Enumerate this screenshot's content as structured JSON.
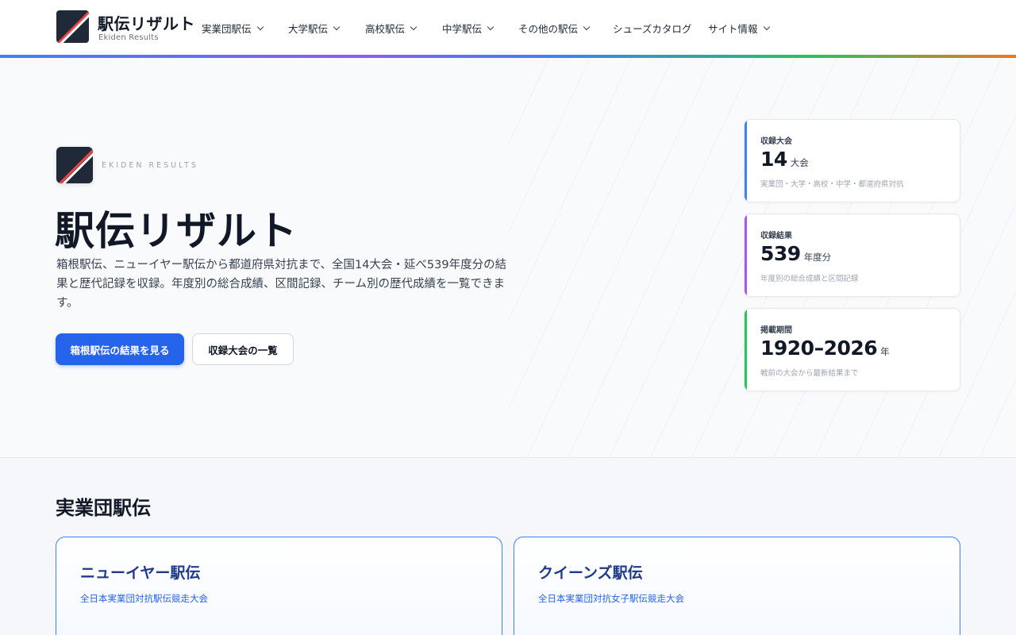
{
  "site": {
    "title": "駅伝リザルト",
    "subtitle": "Ekiden Results"
  },
  "nav": {
    "items": [
      {
        "label": "実業団駅伝",
        "dropdown": true
      },
      {
        "label": "大学駅伝",
        "dropdown": true
      },
      {
        "label": "高校駅伝",
        "dropdown": true
      },
      {
        "label": "中学駅伝",
        "dropdown": true
      },
      {
        "label": "その他の駅伝",
        "dropdown": true
      },
      {
        "label": "シューズカタログ",
        "dropdown": false
      },
      {
        "label": "サイト情報",
        "dropdown": true
      }
    ]
  },
  "hero": {
    "eyebrow": "EKIDEN RESULTS",
    "title": "駅伝リザルト",
    "description": "箱根駅伝、ニューイヤー駅伝から都道府県対抗まで、全国14大会・延べ539年度分の結果と歴代記録を収録。年度別の総合成績、区間記録、チーム別の歴代成績を一覧できます。",
    "primary_button": "箱根駅伝の結果を見る",
    "secondary_button": "収録大会の一覧"
  },
  "stats": [
    {
      "label": "収録大会",
      "value": "14",
      "unit": "大会",
      "note": "実業団・大学・高校・中学・都道府県対抗",
      "color": "#3b82f6"
    },
    {
      "label": "収録結果",
      "value": "539",
      "unit": "年度分",
      "note": "年度別の総合成績と区間記録",
      "color": "#a855f7"
    },
    {
      "label": "掲載期間",
      "value": "1920–2026",
      "unit": "年",
      "note": "戦前の大会から最新結果まで",
      "color": "#22c55e"
    }
  ],
  "section": {
    "title": "実業団駅伝",
    "cards": [
      {
        "name": "ニューイヤー駅伝",
        "subtitle": "全日本実業団対抗駅伝競走大会"
      },
      {
        "name": "クイーンズ駅伝",
        "subtitle": "全日本実業団対抗女子駅伝競走大会"
      }
    ]
  },
  "colors": {
    "accent": "#2563eb",
    "logo_bg": "#1f2937",
    "logo_stripe_red": "#ef4444",
    "logo_stripe_white": "#ffffff"
  },
  "icons": {
    "logo": "diagonal-stripe-logo-icon",
    "nav_dropdown": "chevron-down-icon"
  }
}
